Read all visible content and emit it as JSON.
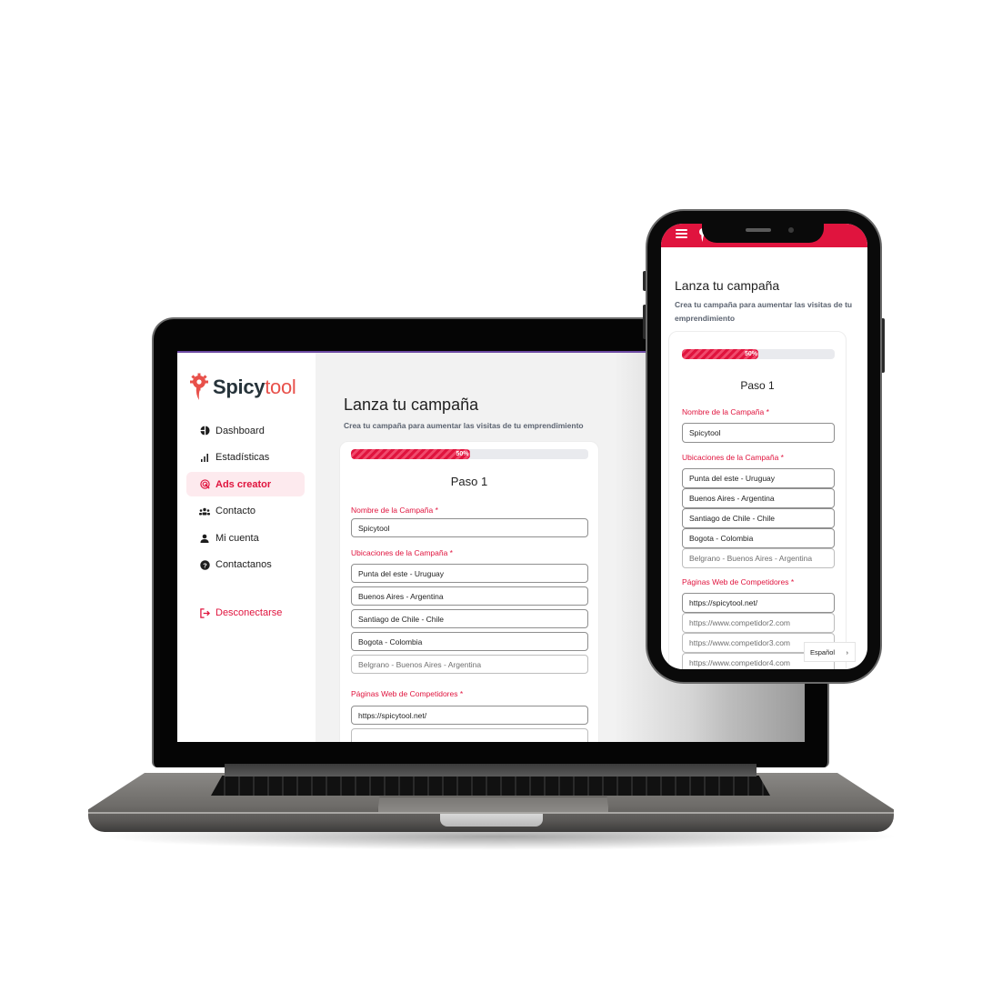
{
  "brand": {
    "name_main": "Spicy",
    "name_accent": "tool",
    "accent_color": "#e0143e",
    "logo_color": "#e8504a",
    "dark_text_color": "#26333a"
  },
  "sidebar": {
    "items": [
      {
        "label": "Dashboard",
        "icon": "dashboard-icon",
        "active": false
      },
      {
        "label": "Estadísticas",
        "icon": "bar-chart-icon",
        "active": false
      },
      {
        "label": "Ads creator",
        "icon": "ads-target-icon",
        "active": true
      },
      {
        "label": "Contacto",
        "icon": "contacts-group-icon",
        "active": false
      },
      {
        "label": "Mi cuenta",
        "icon": "user-icon",
        "active": false
      },
      {
        "label": "Contactanos",
        "icon": "help-icon",
        "active": false
      }
    ],
    "logout_label": "Desconectarse"
  },
  "page": {
    "title": "Lanza tu campaña",
    "subtitle": "Crea tu campaña para aumentar las visitas de tu emprendimiento"
  },
  "form": {
    "progress_percent": 50,
    "progress_label": "50%",
    "step_label": "Paso 1",
    "campaign_name": {
      "label": "Nombre de la Campaña *",
      "value": "Spicytool"
    },
    "locations": {
      "label": "Ubicaciones de la Campaña *",
      "values": [
        "Punta del este - Uruguay",
        "Buenos Aires - Argentina",
        "Santiago de Chile - Chile",
        "Bogota - Colombia"
      ],
      "placeholder": "Belgrano - Buenos Aires - Argentina"
    },
    "competitors": {
      "label": "Páginas Web de Competidores *",
      "values": [
        "https://spicytool.net/"
      ],
      "placeholders": [
        "https://www.competidor2.com",
        "https://www.competidor3.com",
        "https://www.competidor4.com"
      ]
    }
  },
  "language_selector": {
    "label": "Español",
    "icon": "chevron-right-icon"
  }
}
